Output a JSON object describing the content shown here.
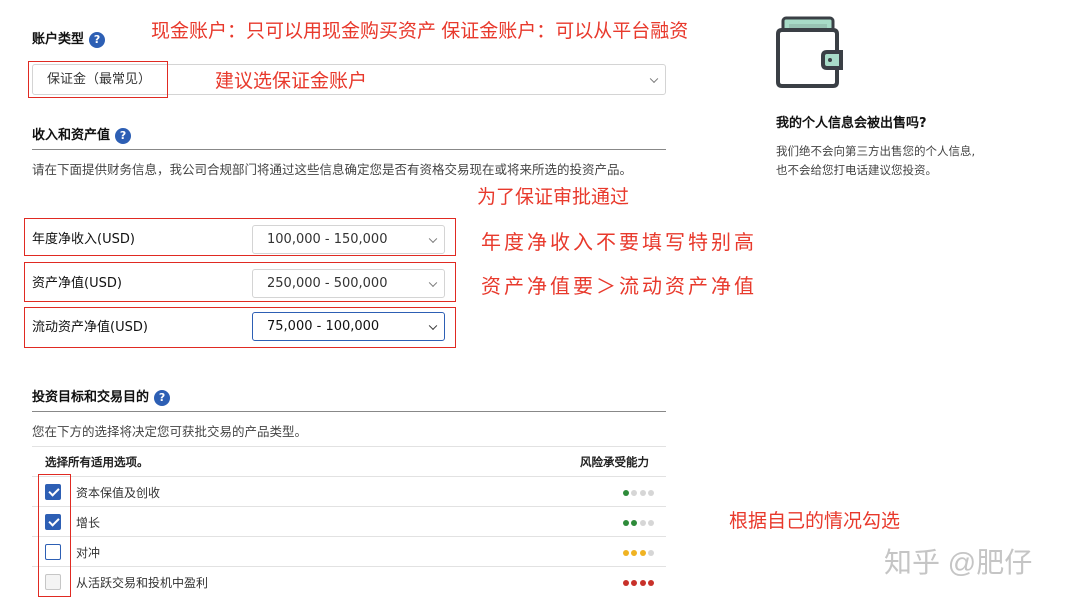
{
  "account_type": {
    "title": "账户类型",
    "help_icon": "?",
    "selected": "保证金（最常见）",
    "annotation_top": "现金账户：只可以用现金购买资产   保证金账户：可以从平台融资",
    "annotation_select": "建议选保证金账户"
  },
  "income": {
    "title": "收入和资产值",
    "help_icon": "?",
    "description": "请在下面提供财务信息，我公司合规部门将通过这些信息确定您是否有资格交易现在或将来所选的投资产品。",
    "annotation": "为了保证审批通过",
    "fields": [
      {
        "label": "年度净收入(USD)",
        "value": "100,000 - 150,000",
        "annotation": "年度净收入不要填写特别高"
      },
      {
        "label": "资产净值(USD)",
        "value": "250,000 - 500,000",
        "annotation": "资产净值要＞流动资产净值"
      },
      {
        "label": "流动资产净值(USD)",
        "value": "75,000 - 100,000"
      }
    ]
  },
  "objectives": {
    "title": "投资目标和交易目的",
    "help_icon": "?",
    "description": "您在下方的选择将决定您可获批交易的产品类型。",
    "select_all_header": "选择所有适用选项。",
    "risk_header": "风险承受能力",
    "options": [
      {
        "label": "资本保值及创收",
        "checked": true,
        "disabled": false,
        "risk_level": 1,
        "risk_color": "#2e8b3a"
      },
      {
        "label": "增长",
        "checked": true,
        "disabled": false,
        "risk_level": 2,
        "risk_color": "#2e8b3a"
      },
      {
        "label": "对冲",
        "checked": false,
        "disabled": false,
        "risk_level": 3,
        "risk_color": "#f0b323"
      },
      {
        "label": "从活跃交易和投机中盈利",
        "checked": false,
        "disabled": true,
        "risk_level": 4,
        "risk_color": "#c8312a"
      }
    ],
    "annotation": "根据自己的情况勾选"
  },
  "privacy": {
    "icon": "wallet-icon",
    "title": "我的个人信息会被出售吗?",
    "body_line1": "我们绝不会向第三方出售您的个人信息,",
    "body_line2": "也不会给您打电话建议您投资。"
  },
  "watermark": "知乎 @肥仔",
  "colors": {
    "accent": "#2d5fb4",
    "annotation": "#e8392c"
  }
}
